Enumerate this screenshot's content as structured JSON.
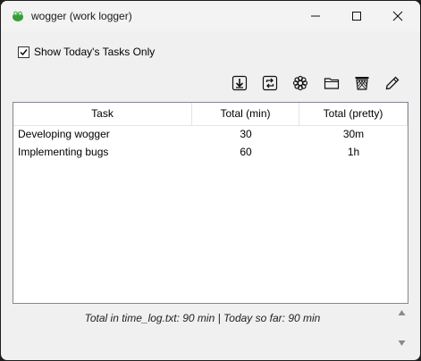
{
  "window": {
    "title": "wogger (work logger)"
  },
  "options": {
    "today_only_label": "Show Today's Tasks Only",
    "today_only_checked": true
  },
  "toolbar": {
    "icons": [
      "download-icon",
      "refresh-icon",
      "settings-icon",
      "folder-icon",
      "trash-icon",
      "pencil-icon"
    ]
  },
  "table": {
    "headers": [
      "Task",
      "Total (min)",
      "Total (pretty)"
    ],
    "rows": [
      [
        "Developing wogger",
        "30",
        "30m"
      ],
      [
        "Implementing bugs",
        "60",
        "1h"
      ]
    ]
  },
  "status": {
    "text": "Total in time_log.txt: 90 min | Today so far: 90 min"
  }
}
